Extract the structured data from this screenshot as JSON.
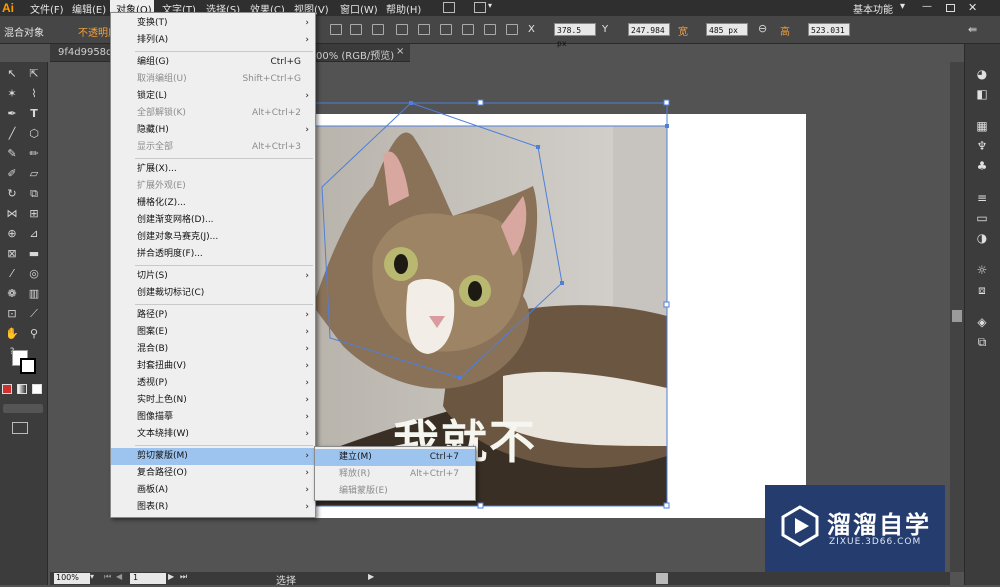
{
  "menubar": {
    "logo": "Ai",
    "items": [
      "文件(F)",
      "编辑(E)",
      "对象(O)",
      "文字(T)",
      "选择(S)",
      "效果(C)",
      "视图(V)",
      "窗口(W)",
      "帮助(H)"
    ],
    "workspace": "基本功能",
    "workspace_arrow": "▾"
  },
  "control_bar": {
    "selection_label": "混合对象",
    "opacity_label": "不透明度",
    "x_value": "378.5 px",
    "y_value": "247.984",
    "w_value": "485 px",
    "h_value": "523.031",
    "x_label": "X",
    "y_label": "Y",
    "w_label": "宽",
    "h_label": "高"
  },
  "document": {
    "tab_title": "9f4d9958d1",
    "tab_suffix": "00% (RGB/预览)",
    "tab_close": "×",
    "caption": "我就不"
  },
  "object_menu": {
    "items": [
      {
        "label": "变换(T)",
        "shortcut": "",
        "submenu": true,
        "disabled": false
      },
      {
        "label": "排列(A)",
        "shortcut": "",
        "submenu": true,
        "disabled": false
      },
      {
        "sep": true
      },
      {
        "label": "编组(G)",
        "shortcut": "Ctrl+G",
        "submenu": false,
        "disabled": false
      },
      {
        "label": "取消编组(U)",
        "shortcut": "Shift+Ctrl+G",
        "submenu": false,
        "disabled": true
      },
      {
        "label": "锁定(L)",
        "shortcut": "",
        "submenu": true,
        "disabled": false
      },
      {
        "label": "全部解锁(K)",
        "shortcut": "Alt+Ctrl+2",
        "submenu": false,
        "disabled": true
      },
      {
        "label": "隐藏(H)",
        "shortcut": "",
        "submenu": true,
        "disabled": false
      },
      {
        "label": "显示全部",
        "shortcut": "Alt+Ctrl+3",
        "submenu": false,
        "disabled": true
      },
      {
        "sep": true
      },
      {
        "label": "扩展(X)...",
        "shortcut": "",
        "submenu": false,
        "disabled": false
      },
      {
        "label": "扩展外观(E)",
        "shortcut": "",
        "submenu": false,
        "disabled": true
      },
      {
        "label": "栅格化(Z)...",
        "shortcut": "",
        "submenu": false,
        "disabled": false
      },
      {
        "label": "创建渐变网格(D)...",
        "shortcut": "",
        "submenu": false,
        "disabled": false
      },
      {
        "label": "创建对象马赛克(J)...",
        "shortcut": "",
        "submenu": false,
        "disabled": false
      },
      {
        "label": "拼合透明度(F)...",
        "shortcut": "",
        "submenu": false,
        "disabled": false
      },
      {
        "sep": true
      },
      {
        "label": "切片(S)",
        "shortcut": "",
        "submenu": true,
        "disabled": false
      },
      {
        "label": "创建裁切标记(C)",
        "shortcut": "",
        "submenu": false,
        "disabled": false
      },
      {
        "sep": true
      },
      {
        "label": "路径(P)",
        "shortcut": "",
        "submenu": true,
        "disabled": false
      },
      {
        "label": "图案(E)",
        "shortcut": "",
        "submenu": true,
        "disabled": false
      },
      {
        "label": "混合(B)",
        "shortcut": "",
        "submenu": true,
        "disabled": false
      },
      {
        "label": "封套扭曲(V)",
        "shortcut": "",
        "submenu": true,
        "disabled": false
      },
      {
        "label": "透视(P)",
        "shortcut": "",
        "submenu": true,
        "disabled": false
      },
      {
        "label": "实时上色(N)",
        "shortcut": "",
        "submenu": true,
        "disabled": false
      },
      {
        "label": "图像描摹",
        "shortcut": "",
        "submenu": true,
        "disabled": false
      },
      {
        "label": "文本绕排(W)",
        "shortcut": "",
        "submenu": true,
        "disabled": false
      },
      {
        "sep": true
      },
      {
        "label": "剪切蒙版(M)",
        "shortcut": "",
        "submenu": true,
        "disabled": false,
        "highlight": true
      },
      {
        "label": "复合路径(O)",
        "shortcut": "",
        "submenu": true,
        "disabled": false
      },
      {
        "label": "画板(A)",
        "shortcut": "",
        "submenu": true,
        "disabled": false
      },
      {
        "label": "图表(R)",
        "shortcut": "",
        "submenu": true,
        "disabled": false
      }
    ]
  },
  "clip_submenu": {
    "items": [
      {
        "label": "建立(M)",
        "shortcut": "Ctrl+7",
        "disabled": false,
        "highlight": true
      },
      {
        "label": "释放(R)",
        "shortcut": "Alt+Ctrl+7",
        "disabled": true
      },
      {
        "label": "编辑蒙版(E)",
        "shortcut": "",
        "disabled": true
      }
    ]
  },
  "status": {
    "zoom": "100%",
    "artboard": "1",
    "tool": "选择"
  },
  "watermark": {
    "brand": "溜溜自学",
    "site": "ZIXUE.3D66.COM"
  }
}
